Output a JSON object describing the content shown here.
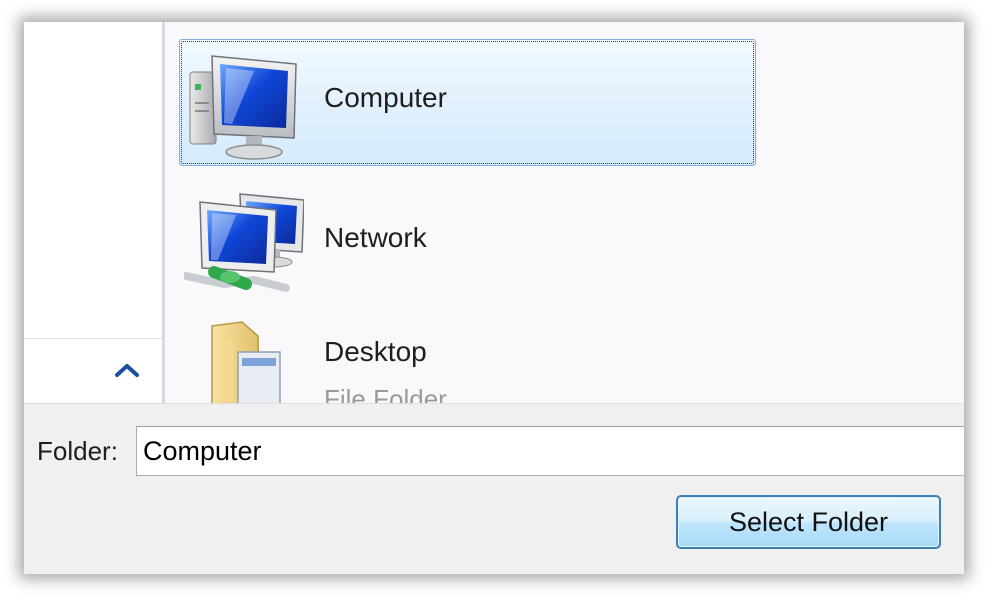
{
  "files": [
    {
      "name": "Computer",
      "subtitle": "",
      "icon": "computer-icon",
      "selected": true
    },
    {
      "name": "Network",
      "subtitle": "",
      "icon": "network-icon",
      "selected": false
    },
    {
      "name": "Desktop",
      "subtitle": "File Folder",
      "icon": "folder-icon",
      "selected": false
    }
  ],
  "navpane": {
    "collapse_icon": "chevron-up-icon",
    "accent": "#1c4ea3"
  },
  "footer": {
    "folder_label": "Folder:",
    "folder_value": "Computer",
    "select_button": "Select Folder"
  },
  "colors": {
    "selection": "#d4ebfc",
    "selection_border": "#84acdd",
    "button_border": "#3c7fb1"
  }
}
